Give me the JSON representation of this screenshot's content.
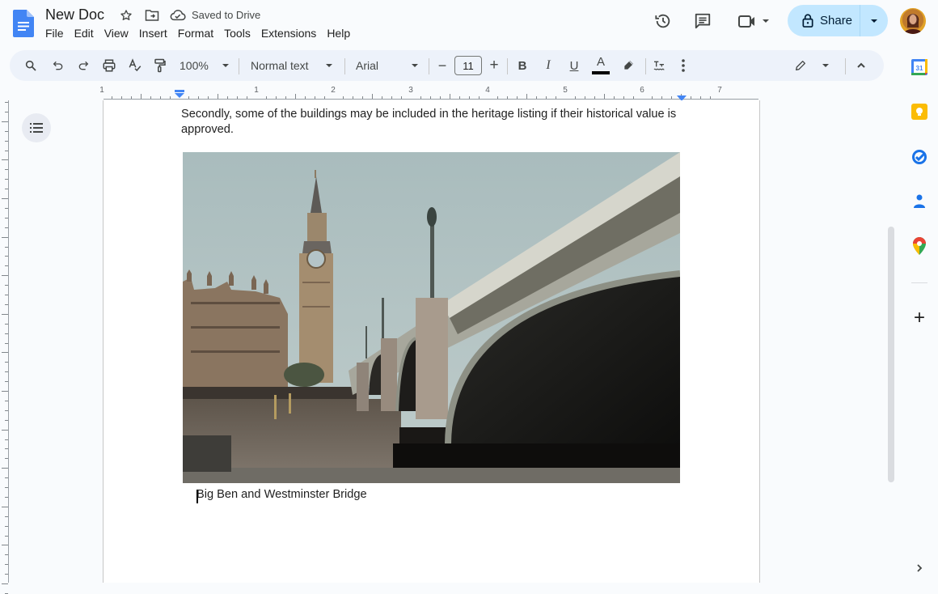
{
  "app": {
    "title": "New Doc",
    "saved_status": "Saved to Drive",
    "brand_color": "#4285f4"
  },
  "menu": [
    "File",
    "Edit",
    "View",
    "Insert",
    "Format",
    "Tools",
    "Extensions",
    "Help"
  ],
  "header_actions": {
    "version_history_icon": "history-icon",
    "comments_icon": "comment-icon",
    "meet_icon": "video-camera-icon",
    "share_label": "Share",
    "share_color": "#c2e7ff"
  },
  "toolbar": {
    "zoom": "100%",
    "style": "Normal text",
    "font": "Arial",
    "font_size": "11",
    "minus": "−",
    "plus": "+",
    "bold": "B",
    "italic": "I",
    "underline": "U",
    "text_color_letter": "A",
    "text_color": "#000000"
  },
  "ruler": {
    "labels": [
      "1",
      "1",
      "2",
      "3",
      "4",
      "5",
      "6",
      "7"
    ]
  },
  "document": {
    "paragraph": "Secondly, some of the buildings may be included in the heritage listing if their historical value is approved.",
    "image_alt": "Big Ben and Westminster Bridge photo",
    "caption": "Big Ben and Westminster Bridge"
  },
  "side_panel": [
    "calendar-icon",
    "keep-icon",
    "tasks-icon",
    "contacts-icon",
    "maps-icon"
  ],
  "side_panel_add": "+"
}
